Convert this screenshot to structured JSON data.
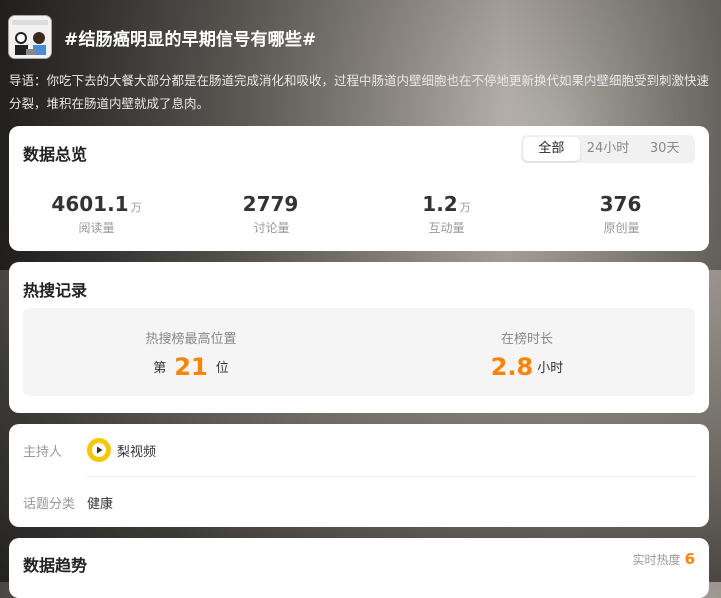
{
  "topic": {
    "title": "#结肠癌明显的早期信号有哪些#",
    "lead": "导语：你吃下去的大餐大部分都是在肠道完成消化和吸收，过程中肠道内壁细胞也在不停地更新换代如果内壁细胞受到刺激快速分裂，堆积在肠道内壁就成了息肉。",
    "icon": "topic-cover-icon"
  },
  "overview": {
    "title": "数据总览",
    "filters": [
      "全部",
      "24小时",
      "30天"
    ],
    "active_filter": "全部",
    "stats": [
      {
        "value": "4601.1",
        "unit": "万",
        "label": "阅读量"
      },
      {
        "value": "2779",
        "unit": "",
        "label": "讨论量"
      },
      {
        "value": "1.2",
        "unit": "万",
        "label": "互动量"
      },
      {
        "value": "376",
        "unit": "",
        "label": "原创量"
      }
    ]
  },
  "hot_record": {
    "title": "热搜记录",
    "peak_label": "热搜榜最高位置",
    "peak_prefix": "第",
    "peak_value": "21",
    "peak_suffix": "位",
    "duration_label": "在榜时长",
    "duration_value": "2.8",
    "duration_unit": "小时"
  },
  "info": {
    "host_label": "主持人",
    "host_name": "梨视频",
    "host_icon": "pear-video-logo-icon",
    "category_label": "话题分类",
    "category_value": "健康"
  },
  "trend": {
    "title": "数据趋势",
    "realtime_label": "实时热度",
    "realtime_value": "6"
  },
  "colors": {
    "accent": "#ff8200",
    "card_bg": "#ffffff",
    "muted": "#999999"
  }
}
